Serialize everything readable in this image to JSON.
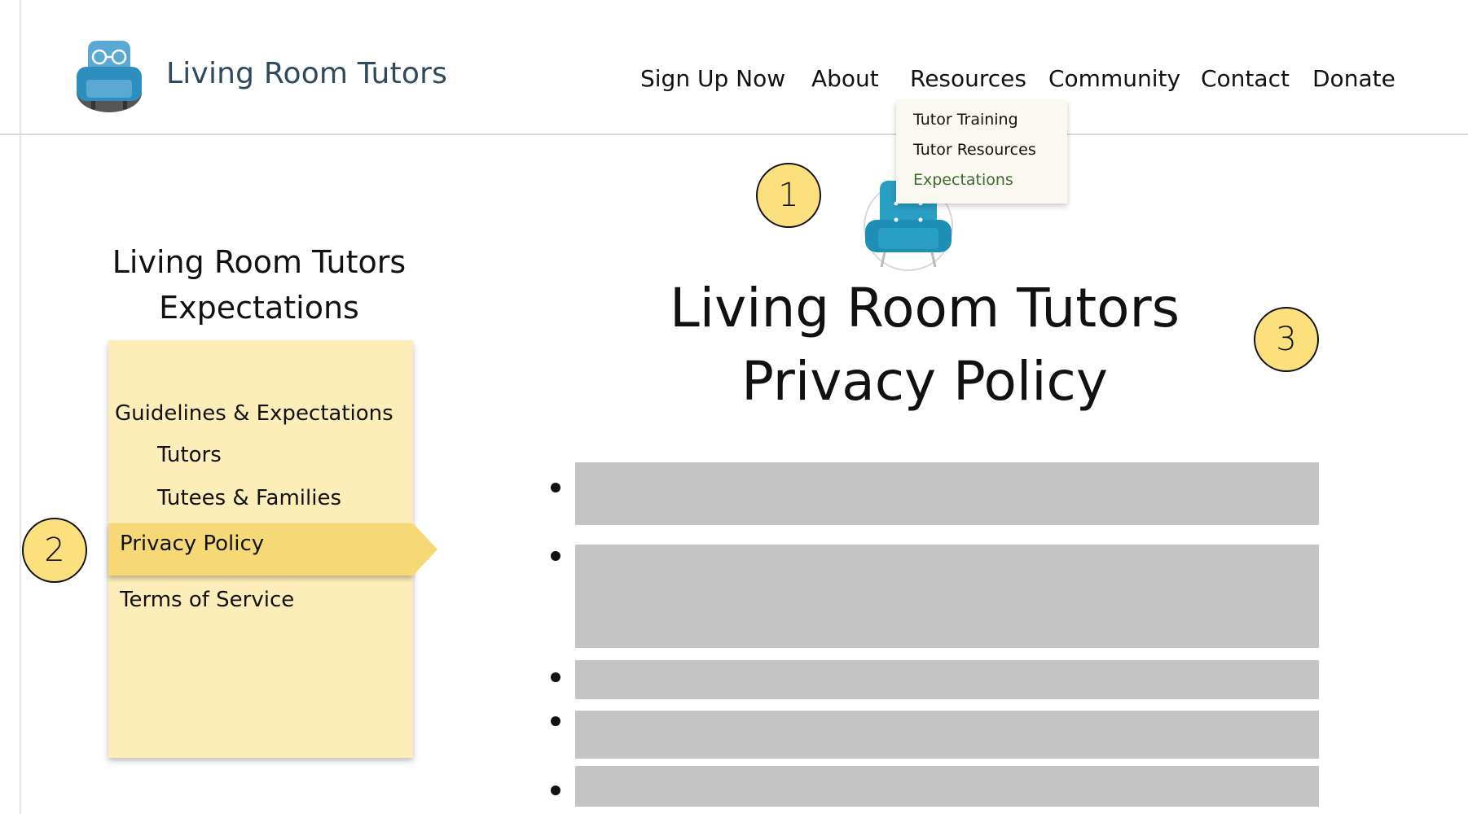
{
  "header": {
    "brand": "Living Room Tutors",
    "nav": [
      "Sign Up Now",
      "About",
      "Resources",
      "Community",
      "Contact",
      "Donate"
    ]
  },
  "dropdown": {
    "items": [
      "Tutor Training",
      "Tutor Resources",
      "Expectations"
    ],
    "active_index": 2
  },
  "callouts": [
    "1",
    "2",
    "3"
  ],
  "sidebar": {
    "title_line1": "Living Room Tutors",
    "title_line2": "Expectations",
    "links": [
      "Guidelines & Expectations",
      "Tutors",
      "Tutees & Families",
      "Privacy Policy",
      "Terms of Service"
    ],
    "active": "Privacy Policy"
  },
  "main": {
    "title_line1": "Living Room Tutors",
    "title_line2": "Privacy Policy"
  },
  "colors": {
    "brand_text": "#2f4a5e",
    "chair_teal": "#2a9fc4",
    "callout_fill": "#fbe07d",
    "sidebar_bg": "#fdedb8",
    "sidebar_active": "#f6d976",
    "placeholder": "#c4c4c4",
    "dropdown_active": "#3c6b2a"
  }
}
